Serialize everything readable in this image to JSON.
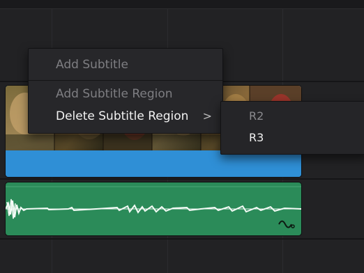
{
  "context_menu": {
    "items": [
      {
        "label": "Add Subtitle",
        "enabled": false
      },
      {
        "label": "Add Subtitle Region",
        "enabled": false
      },
      {
        "label": "Delete Subtitle Region",
        "enabled": true,
        "arrow": ">"
      }
    ]
  },
  "submenu": {
    "items": [
      {
        "label": "R2",
        "enabled": false
      },
      {
        "label": "R3",
        "enabled": true
      }
    ]
  },
  "icons": {
    "automation": "keyframe-curve-icon"
  },
  "colors": {
    "background": "#222224",
    "video_clip": "#2f8fd6",
    "audio_clip": "#2b8b59",
    "menu_bg": "#27272a",
    "disabled_text": "#7e7e82"
  }
}
